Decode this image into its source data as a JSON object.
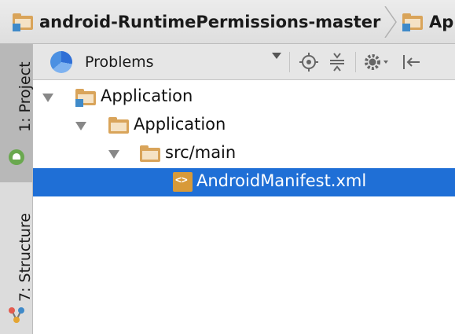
{
  "breadcrumb": {
    "project": "android-RuntimePermissions-master",
    "module": "Ap"
  },
  "toolstrip": {
    "project_tab": "1: Project",
    "structure_tab": "7: Structure"
  },
  "panel": {
    "view_selector": "Problems",
    "tools": [
      "locate-icon",
      "collapse-all-icon",
      "settings-icon",
      "hide-icon"
    ]
  },
  "tree": [
    {
      "label": "Application",
      "level": 0,
      "expanded": true,
      "icon": "module-folder-icon",
      "selected": false
    },
    {
      "label": "Application",
      "level": 1,
      "expanded": true,
      "icon": "folder-icon",
      "selected": false
    },
    {
      "label": "src/main",
      "level": 2,
      "expanded": true,
      "icon": "folder-icon",
      "selected": false
    },
    {
      "label": "AndroidManifest.xml",
      "level": 3,
      "expanded": false,
      "icon": "xml-file-icon",
      "selected": true
    }
  ],
  "colors": {
    "selection": "#1f6fd6",
    "folder": "#d9a45a",
    "android": "#6aa84f"
  }
}
